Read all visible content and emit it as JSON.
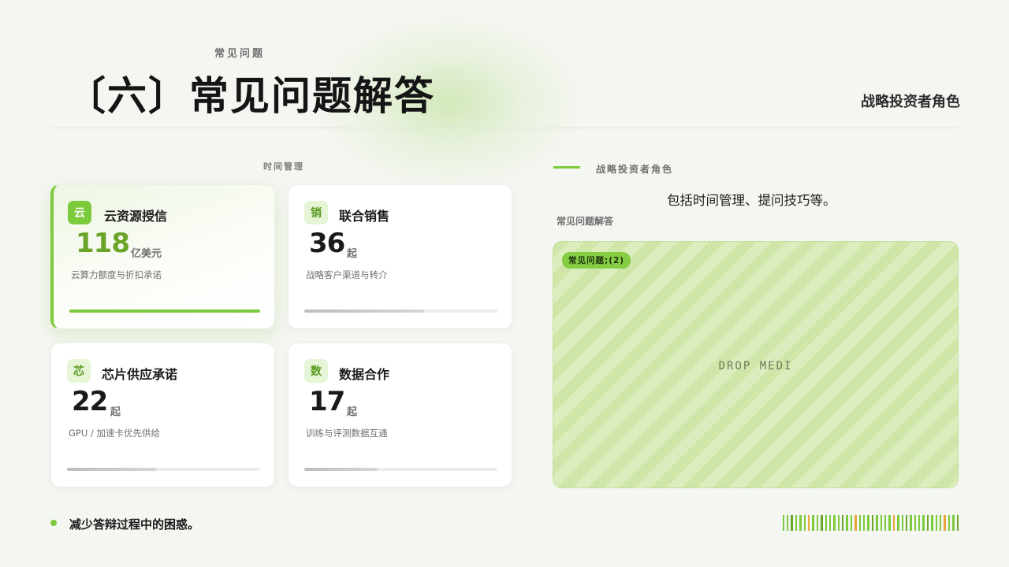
{
  "header": {
    "eyebrow": "常见问题",
    "title": "〔六〕常见问题解答",
    "right_label": "战略投资者角色"
  },
  "left": {
    "label": "时间管理",
    "cards": [
      {
        "badge": "云",
        "title": "云资源授信",
        "value": "118",
        "unit": "亿美元",
        "desc": "云算力额度与折扣承诺",
        "progress": 1.0,
        "active": true
      },
      {
        "badge": "销",
        "title": "联合销售",
        "value": "36",
        "unit": "起",
        "desc": "战略客户渠道与转介",
        "progress": 0.62,
        "active": false
      },
      {
        "badge": "芯",
        "title": "芯片供应承诺",
        "value": "22",
        "unit": "起",
        "desc": "GPU / 加速卡优先供给",
        "progress": 0.46,
        "active": false
      },
      {
        "badge": "数",
        "title": "数据合作",
        "value": "17",
        "unit": "起",
        "desc": "训练与评测数据互通",
        "progress": 0.38,
        "active": false
      }
    ]
  },
  "right": {
    "label": "战略投资者角色",
    "text": "包括时间管理、提问技巧等。",
    "sub": "常见问题解答",
    "dropzone": {
      "tag": "常见问题;(2)",
      "text": "DROP MEDI"
    }
  },
  "footer": {
    "bullet": "减少答辩过程中的困惑。"
  },
  "colors": {
    "accent": "#7ccb3d",
    "accent_dark": "#6aa52a",
    "orange": "#e8a53c"
  }
}
